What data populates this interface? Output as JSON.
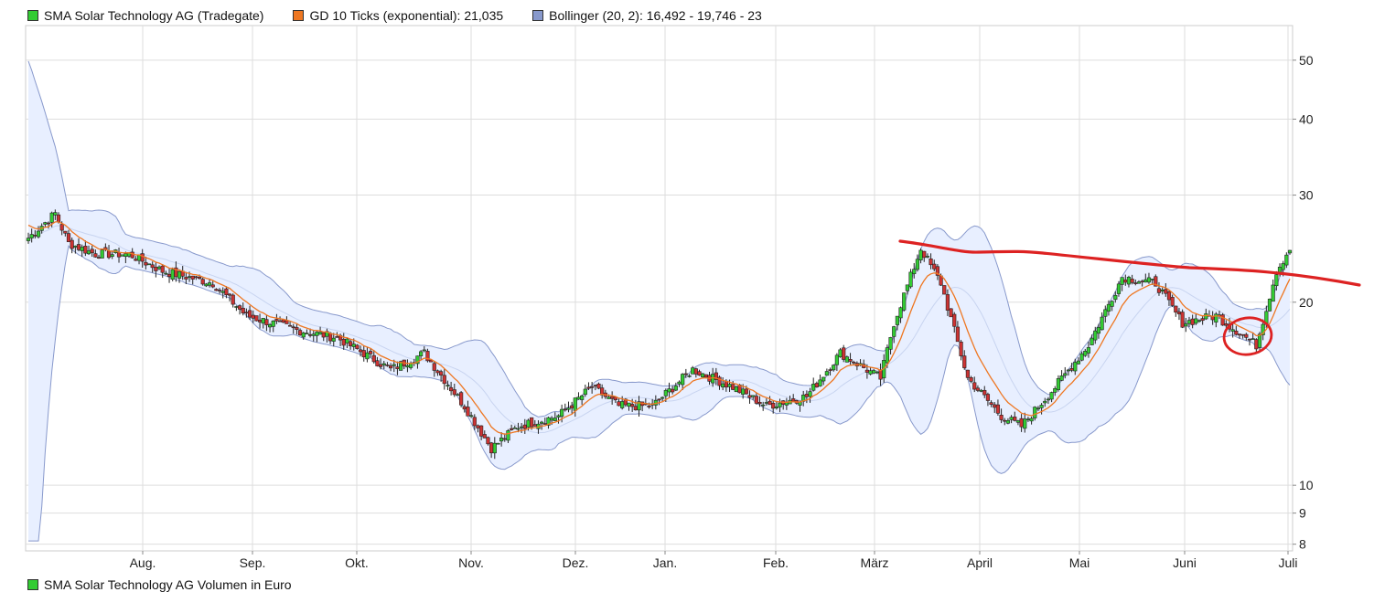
{
  "legend": [
    {
      "label": "SMA Solar Technology AG (Tradegate)",
      "color": "#33cc33"
    },
    {
      "label": "GD 10 Ticks (exponential): 21,035",
      "color": "#ee7722"
    },
    {
      "label": "Bollinger (20, 2): 16,492 - 19,746 - 23",
      "color": "#8899cc"
    }
  ],
  "volume_legend": {
    "label": "SMA Solar Technology AG Volumen in Euro",
    "color": "#33cc33"
  },
  "chart_data": {
    "type": "candlestick",
    "yscale": "log",
    "ylim": [
      7.8,
      57
    ],
    "yticks": [
      8,
      9,
      10,
      20,
      30,
      40,
      50
    ],
    "months": [
      "Aug.",
      "Sep.",
      "Okt.",
      "Nov.",
      "Dez.",
      "Jan.",
      "Feb.",
      "März",
      "April",
      "Mai",
      "Juni",
      "Juli"
    ],
    "price_keypoints": [
      [
        0,
        25.5
      ],
      [
        8,
        28
      ],
      [
        12,
        25
      ],
      [
        20,
        24
      ],
      [
        30,
        24
      ],
      [
        40,
        22.5
      ],
      [
        55,
        21.5
      ],
      [
        65,
        19
      ],
      [
        80,
        18
      ],
      [
        92,
        17.5
      ],
      [
        108,
        15.5
      ],
      [
        118,
        16.5
      ],
      [
        130,
        13.5
      ],
      [
        138,
        11.5
      ],
      [
        146,
        12.5
      ],
      [
        158,
        13
      ],
      [
        168,
        14.5
      ],
      [
        176,
        13.5
      ],
      [
        186,
        13.5
      ],
      [
        198,
        15.5
      ],
      [
        210,
        14.5
      ],
      [
        220,
        13.5
      ],
      [
        232,
        14
      ],
      [
        242,
        16.5
      ],
      [
        254,
        15
      ],
      [
        258,
        18.5
      ],
      [
        266,
        24.5
      ],
      [
        272,
        21.5
      ],
      [
        280,
        15
      ],
      [
        290,
        13
      ],
      [
        296,
        12.5
      ],
      [
        306,
        14.5
      ],
      [
        316,
        17
      ],
      [
        326,
        22
      ],
      [
        336,
        21.5
      ],
      [
        344,
        18.5
      ],
      [
        354,
        19
      ],
      [
        366,
        17
      ],
      [
        372,
        22.5
      ],
      [
        376,
        24.5
      ]
    ],
    "ema_color": "#ee7722",
    "bollinger_color": "#8899cc",
    "up_color": "#33cc33",
    "down_color": "#cc3333"
  }
}
